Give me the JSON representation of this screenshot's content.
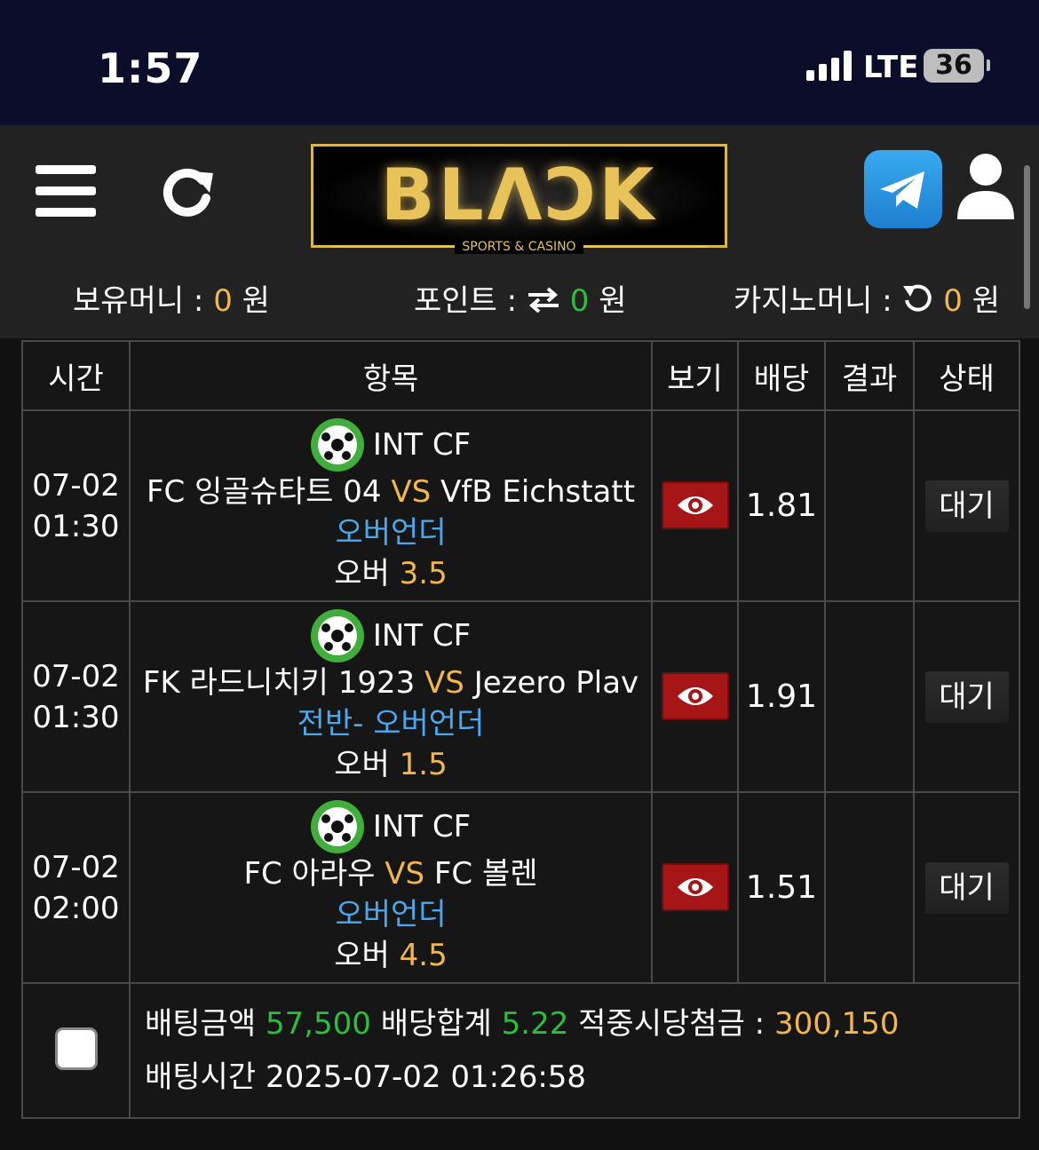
{
  "status_bar": {
    "time": "1:57",
    "network": "LTE",
    "battery": "36"
  },
  "header": {
    "logo_text": "BLΛϽK",
    "logo_subtitle": "SPORTS & CASINO"
  },
  "balances": {
    "money_label": "보유머니 :",
    "money_value": "0",
    "money_unit": "원",
    "point_label": "포인트 :",
    "point_value": "0",
    "point_unit": "원",
    "casino_label": "카지노머니 :",
    "casino_value": "0",
    "casino_unit": "원"
  },
  "table": {
    "headers": [
      "시간",
      "항목",
      "보기",
      "배당",
      "결과",
      "상태"
    ],
    "rows": [
      {
        "date": "07-02",
        "time": "01:30",
        "league": "INT CF",
        "home": "FC 잉골슈타트 04",
        "vs": "VS",
        "away": "VfB Eichstatt",
        "market": "오버언더",
        "pick": "오버",
        "line": "3.5",
        "odds": "1.81",
        "result": "",
        "status": "대기"
      },
      {
        "date": "07-02",
        "time": "01:30",
        "league": "INT CF",
        "home": "FK 라드니치키 1923",
        "vs": "VS",
        "away": "Jezero Plav",
        "market": "전반- 오버언더",
        "pick": "오버",
        "line": "1.5",
        "odds": "1.91",
        "result": "",
        "status": "대기"
      },
      {
        "date": "07-02",
        "time": "02:00",
        "league": "INT CF",
        "home": "FC 아라우",
        "vs": "VS",
        "away": "FC 볼렌",
        "market": "오버언더",
        "pick": "오버",
        "line": "4.5",
        "odds": "1.51",
        "result": "",
        "status": "대기"
      }
    ]
  },
  "summary": {
    "bet_amount_label": "배팅금액",
    "bet_amount": "57,500",
    "odds_total_label": "배당합계",
    "odds_total": "5.22",
    "payout_label": "적중시당첨금 :",
    "payout": "300,150",
    "bet_time_label": "배팅시간",
    "bet_time": "2025-07-02 01:26:58"
  },
  "colors": {
    "accent_orange": "#f2b64b",
    "accent_green": "#2bbf3c",
    "accent_blue": "#4aa8ee",
    "eye_button_red": "#a71616",
    "logo_gold": "#e8c35a"
  }
}
